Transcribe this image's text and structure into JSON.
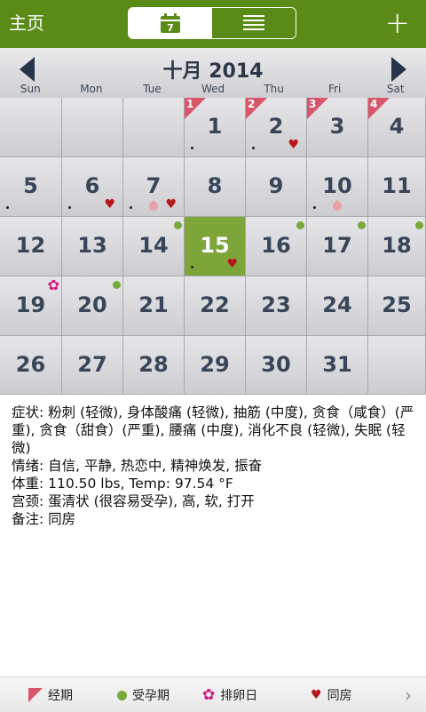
{
  "topbar": {
    "home_label": "主页",
    "add_label": "+",
    "calendar_day_num": "7"
  },
  "calendar": {
    "month_title": "十月 2014",
    "weekdays": [
      "Sun",
      "Mon",
      "Tue",
      "Wed",
      "Thu",
      "Fri",
      "Sat"
    ],
    "rows": [
      [
        {
          "day": ""
        },
        {
          "day": ""
        },
        {
          "day": ""
        },
        {
          "day": "1",
          "period": "1",
          "dot": true
        },
        {
          "day": "2",
          "period": "2",
          "dot": true,
          "heart": true
        },
        {
          "day": "3",
          "period": "3"
        },
        {
          "day": "4",
          "period": "4"
        }
      ],
      [
        {
          "day": "5",
          "dot": true
        },
        {
          "day": "6",
          "dot": true,
          "heart": true
        },
        {
          "day": "7",
          "dot": true,
          "drop": true,
          "heart": true
        },
        {
          "day": "8"
        },
        {
          "day": "9"
        },
        {
          "day": "10",
          "dot": true,
          "drop": true
        },
        {
          "day": "11"
        }
      ],
      [
        {
          "day": "12"
        },
        {
          "day": "13"
        },
        {
          "day": "14",
          "fertile": true
        },
        {
          "day": "15",
          "selected": true,
          "fertile": true,
          "dot": true,
          "heart": true
        },
        {
          "day": "16",
          "fertile": true
        },
        {
          "day": "17",
          "fertile": true
        },
        {
          "day": "18",
          "fertile": true
        }
      ],
      [
        {
          "day": "19",
          "ovulation": true
        },
        {
          "day": "20",
          "fertile": true
        },
        {
          "day": "21"
        },
        {
          "day": "22"
        },
        {
          "day": "23"
        },
        {
          "day": "24"
        },
        {
          "day": "25"
        }
      ],
      [
        {
          "day": "26"
        },
        {
          "day": "27"
        },
        {
          "day": "28"
        },
        {
          "day": "29"
        },
        {
          "day": "30"
        },
        {
          "day": "31"
        },
        {
          "day": ""
        }
      ]
    ]
  },
  "details": {
    "symptoms": "症状: 粉刺 (轻微), 身体酸痛 (轻微), 抽筋 (中度), 贪食（咸食）(严重), 贪食（甜食）(严重), 腰痛 (中度), 消化不良 (轻微), 失眠 (轻微)",
    "mood": "情绪: 自信, 平静, 热恋中, 精神焕发, 振奋",
    "weight_temp": "体重: 110.50 lbs, Temp: 97.54 °F",
    "cervix": "宫颈: 蛋清状 (很容易受孕), 高, 软, 打开",
    "notes": "备注: 同房"
  },
  "legend": {
    "period": "经期",
    "fertile": "受孕期",
    "ovulation": "排卵日",
    "intercourse": "同房"
  },
  "colors": {
    "brand_green": "#5b8b17",
    "selected_cell": "#7da53a",
    "period_flag": "#d9566a",
    "fertile_dot": "#7aa93b",
    "heart": "#b9151d",
    "ovulation_flower": "#d3197e"
  }
}
